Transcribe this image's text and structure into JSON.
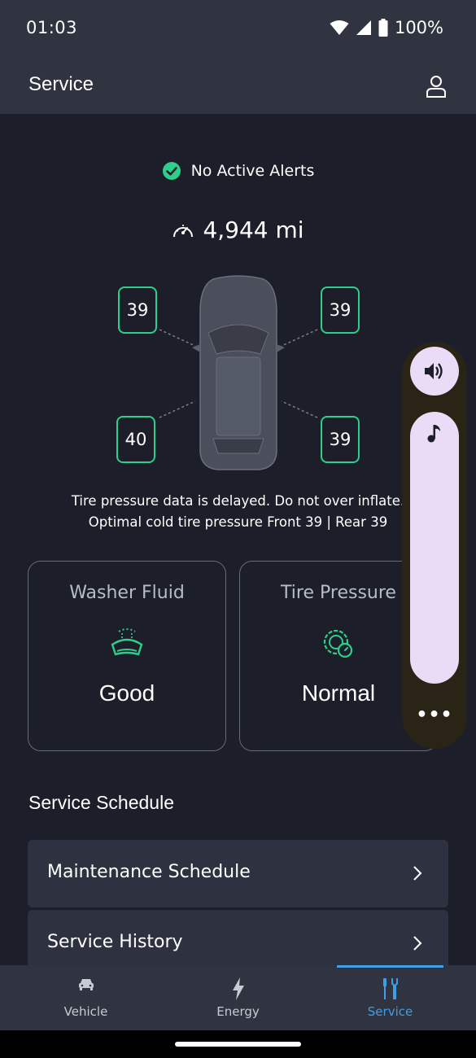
{
  "status_bar": {
    "time": "01:03",
    "battery": "100%"
  },
  "header": {
    "title": "Service"
  },
  "alerts": {
    "text": "No Active Alerts"
  },
  "odometer": {
    "value": "4,944 mi"
  },
  "tires": {
    "front_left": "39",
    "front_right": "39",
    "rear_left": "40",
    "rear_right": "39"
  },
  "pressure_note": {
    "line1": "Tire pressure data is delayed. Do not over inflate.",
    "line2": "Optimal cold tire pressure Front 39 | Rear 39"
  },
  "cards": [
    {
      "title": "Washer Fluid",
      "value": "Good"
    },
    {
      "title": "Tire Pressure",
      "value": "Normal"
    }
  ],
  "service_schedule": {
    "title": "Service Schedule",
    "rows": [
      {
        "label": "Maintenance Schedule"
      },
      {
        "label": "Service History"
      }
    ]
  },
  "bottom_nav": {
    "items": [
      {
        "label": "Vehicle"
      },
      {
        "label": "Energy"
      },
      {
        "label": "Service"
      }
    ],
    "active": "Service"
  },
  "volume_panel": {
    "more_label": "•••"
  },
  "colors": {
    "accent_green": "#2ecf8a",
    "accent_blue": "#3e9ee8",
    "background": "#1c1f29",
    "bar": "#303440",
    "volume_panel": "#eadcf6"
  }
}
